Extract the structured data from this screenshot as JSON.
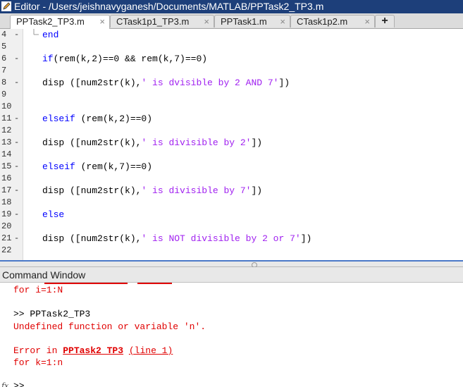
{
  "window": {
    "title": "Editor - /Users/jeishnavyganesh/Documents/MATLAB/PPTask2_TP3.m"
  },
  "tabs": [
    {
      "label": "PPTask2_TP3.m",
      "active": true
    },
    {
      "label": "CTask1p1_TP3.m",
      "active": false
    },
    {
      "label": "PPTask1.m",
      "active": false
    },
    {
      "label": "CTask1p2.m",
      "active": false
    }
  ],
  "tab_close_glyph": "×",
  "tab_add_glyph": "+",
  "editor": {
    "lines": [
      {
        "num": "4",
        "dash": "-",
        "text": "end"
      },
      {
        "num": "5",
        "dash": "",
        "text": ""
      },
      {
        "num": "6",
        "dash": "-",
        "text": "if(rem(k,2)==0 && rem(k,7)==0)"
      },
      {
        "num": "7",
        "dash": "",
        "text": ""
      },
      {
        "num": "8",
        "dash": "-",
        "text": "disp ([num2str(k),' is dvisible by 2 AND 7'])"
      },
      {
        "num": "9",
        "dash": "",
        "text": ""
      },
      {
        "num": "10",
        "dash": "",
        "text": ""
      },
      {
        "num": "11",
        "dash": "-",
        "text": "elseif (rem(k,2)==0)"
      },
      {
        "num": "12",
        "dash": "",
        "text": ""
      },
      {
        "num": "13",
        "dash": "-",
        "text": "disp ([num2str(k),' is divisible by 2'])"
      },
      {
        "num": "14",
        "dash": "",
        "text": ""
      },
      {
        "num": "15",
        "dash": "-",
        "text": "elseif (rem(k,7)==0)"
      },
      {
        "num": "16",
        "dash": "",
        "text": ""
      },
      {
        "num": "17",
        "dash": "-",
        "text": "disp ([num2str(k),' is divisible by 7'])"
      },
      {
        "num": "18",
        "dash": "",
        "text": ""
      },
      {
        "num": "19",
        "dash": "-",
        "text": "else"
      },
      {
        "num": "20",
        "dash": "",
        "text": ""
      },
      {
        "num": "21",
        "dash": "-",
        "text": "disp ([num2str(k),' is NOT divisible by 2 or 7'])"
      },
      {
        "num": "22",
        "dash": "",
        "text": ""
      }
    ],
    "colors": {
      "keyword": "#0000ff",
      "string": "#a020f0"
    }
  },
  "command_window": {
    "title": "Command Window",
    "lines": [
      {
        "text": "for i=1:N",
        "style": "error"
      },
      {
        "text": "",
        "style": "normal"
      },
      {
        "text": ">> PPTask2_TP3",
        "style": "normal"
      },
      {
        "text": "Undefined function or variable 'n'.",
        "style": "error"
      },
      {
        "text": "",
        "style": "normal"
      },
      {
        "text": "",
        "style": "normal"
      },
      {
        "text": "for k=1:n",
        "style": "error"
      }
    ],
    "error_in": {
      "prefix": "Error in ",
      "link": "PPTask2_TP3",
      "space": " ",
      "line_link": "(line 1)"
    },
    "fx_label": "fx",
    "prompt": ">>"
  },
  "colors": {
    "titlebar": "#1d3f7a",
    "error": "#e00000",
    "accent": "#4a78c8"
  }
}
